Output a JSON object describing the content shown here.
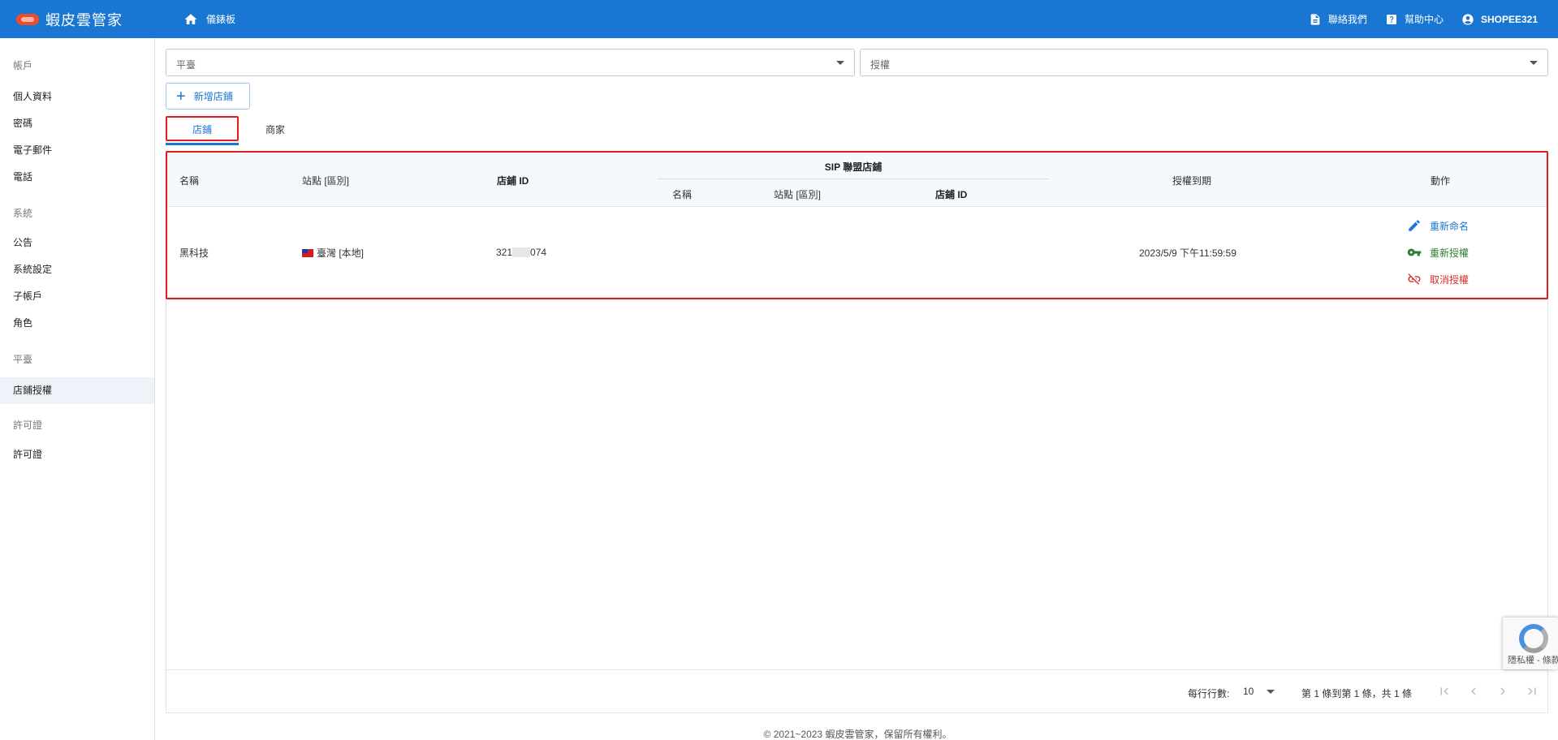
{
  "app": {
    "title": "蝦皮雲管家"
  },
  "topbar": {
    "home_label": "儀錶板",
    "contact_label": "聯絡我們",
    "help_label": "幫助中心",
    "user_label": "SHOPEE321"
  },
  "sidebar": {
    "sections": [
      {
        "title": "帳戶",
        "items": [
          "個人資料",
          "密碼",
          "電子郵件",
          "電話"
        ]
      },
      {
        "title": "系統",
        "items": [
          "公告",
          "系統設定",
          "子帳戶",
          "角色"
        ]
      },
      {
        "title": "平臺",
        "items": [
          "店鋪授權"
        ]
      },
      {
        "title": "許可證",
        "items": [
          "許可證"
        ]
      }
    ],
    "active_item": "店鋪授權"
  },
  "filters": {
    "platform_placeholder": "平臺",
    "auth_placeholder": "授權"
  },
  "add_button_label": "新增店鋪",
  "tabs": [
    {
      "label": "店鋪",
      "active": true
    },
    {
      "label": "商家",
      "active": false
    }
  ],
  "table": {
    "headers": {
      "name": "名稱",
      "site_region": "站點 [區別]",
      "shop_id": "店鋪 ID",
      "sip_group": "SIP 聯盟店鋪",
      "sip_name": "名稱",
      "sip_site_region": "站點 [區別]",
      "sip_shop_id": "店鋪 ID",
      "auth_expiry": "授權到期",
      "actions": "動作"
    },
    "rows": [
      {
        "name": "黑科技",
        "site": "臺灣 [本地]",
        "shop_id_prefix": "321",
        "shop_id_suffix": "074",
        "auth_expiry": "2023/5/9 下午11:59:59",
        "actions": {
          "rename": "重新命名",
          "reauth": "重新授權",
          "revoke": "取消授權"
        }
      }
    ]
  },
  "pagination": {
    "rows_per_page_label": "每行行數:",
    "rows_per_page_value": "10",
    "range_text": "第 1 條到第 1 條，共 1 條"
  },
  "footer": {
    "copyright": "© 2021~2023 蝦皮雲管家，保留所有權利。"
  },
  "recaptcha": {
    "text": "隱私權 - 條款"
  },
  "colors": {
    "primary": "#1976d2",
    "highlight": "#e31b1b",
    "success": "#2e7d32",
    "danger": "#d32f2f"
  }
}
